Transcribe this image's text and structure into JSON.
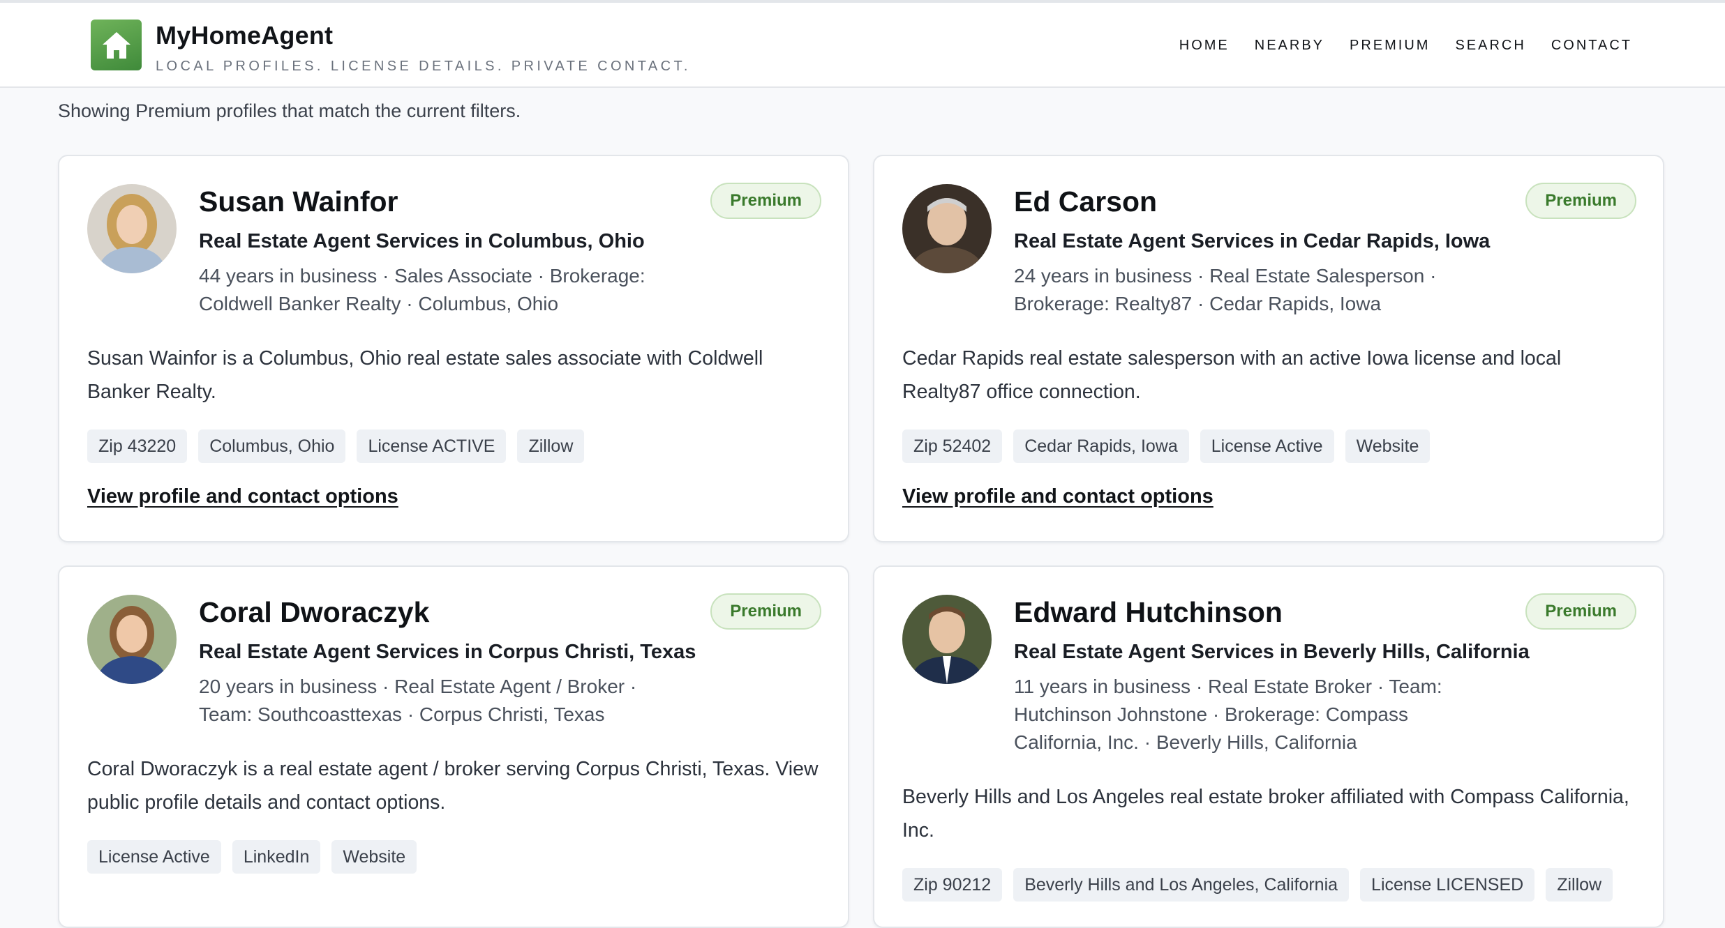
{
  "brand": {
    "name": "MyHomeAgent",
    "tagline": "LOCAL PROFILES. LICENSE DETAILS. PRIVATE CONTACT.",
    "logo_icon": "house-icon",
    "accent_color": "#4f9a43"
  },
  "nav": {
    "home": "HOME",
    "nearby": "NEARBY",
    "premium": "PREMIUM",
    "search": "SEARCH",
    "contact": "CONTACT"
  },
  "intro": "Showing Premium profiles that match the current filters.",
  "cards": [
    {
      "badge": "Premium",
      "name": "Susan Wainfor",
      "subtitle": "Real Estate Agent Services in Columbus, Ohio",
      "meta": "44 years in business · Sales Associate · Brokerage: Coldwell Banker Realty · Columbus, Ohio",
      "description": "Susan Wainfor is a Columbus, Ohio real estate sales associate with Coldwell Banker Realty.",
      "tags": [
        "Zip 43220",
        "Columbus, Ohio",
        "License ACTIVE",
        "Zillow"
      ],
      "link": "View profile and contact options"
    },
    {
      "badge": "Premium",
      "name": "Ed Carson",
      "subtitle": "Real Estate Agent Services in Cedar Rapids, Iowa",
      "meta": "24 years in business · Real Estate Salesperson · Brokerage: Realty87 · Cedar Rapids, Iowa",
      "description": "Cedar Rapids real estate salesperson with an active Iowa license and local Realty87 office connection.",
      "tags": [
        "Zip 52402",
        "Cedar Rapids, Iowa",
        "License Active",
        "Website"
      ],
      "link": "View profile and contact options"
    },
    {
      "badge": "Premium",
      "name": "Coral Dworaczyk",
      "subtitle": "Real Estate Agent Services in Corpus Christi, Texas",
      "meta": "20 years in business · Real Estate Agent / Broker · Team: Southcoasttexas · Corpus Christi, Texas",
      "description": "Coral Dworaczyk is a real estate agent / broker serving Corpus Christi, Texas. View public profile details and contact options.",
      "tags": [
        "License Active",
        "LinkedIn",
        "Website"
      ]
    },
    {
      "badge": "Premium",
      "name": "Edward Hutchinson",
      "subtitle": "Real Estate Agent Services in Beverly Hills, California",
      "meta": "11 years in business · Real Estate Broker · Team: Hutchinson Johnstone · Brokerage: Compass California, Inc. · Beverly Hills, California",
      "description": "Beverly Hills and Los Angeles real estate broker affiliated with Compass California, Inc.",
      "tags": [
        "Zip 90212",
        "Beverly Hills and Los Angeles, California",
        "License LICENSED",
        "Zillow"
      ]
    }
  ]
}
